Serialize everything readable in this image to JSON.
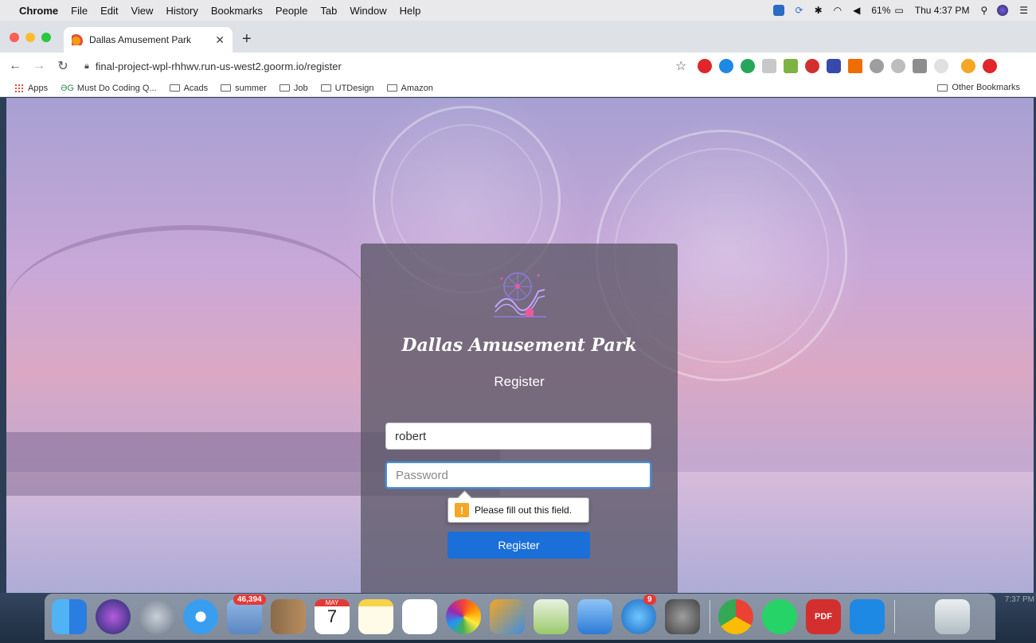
{
  "menubar": {
    "app_name": "Chrome",
    "menus": [
      "File",
      "Edit",
      "View",
      "History",
      "Bookmarks",
      "People",
      "Tab",
      "Window",
      "Help"
    ],
    "battery": "61%",
    "clock": "Thu 4:37 PM"
  },
  "browser": {
    "tab_title": "Dallas Amusement Park",
    "url": "final-project-wpl-rhhwv.run-us-west2.goorm.io/register",
    "bookmarks": [
      "Apps",
      "Must Do Coding Q...",
      "Acads",
      "summer",
      "Job",
      "UTDesign",
      "Amazon"
    ],
    "other_bookmarks": "Other Bookmarks"
  },
  "page": {
    "brand": "Dallas Amusement Park",
    "title": "Register",
    "username_value": "robert",
    "password_placeholder": "Password",
    "validation_message": "Please fill out this field.",
    "submit_label": "Register"
  },
  "dock": {
    "mail_badge": "46,394",
    "calendar_month": "MAY",
    "calendar_day": "7",
    "appstore_badge": "9",
    "corner_time": "7:37 PM"
  },
  "colors": {
    "accent": "#1a6fd8",
    "card_bg": "#5c5868",
    "warning": "#f5a623"
  }
}
